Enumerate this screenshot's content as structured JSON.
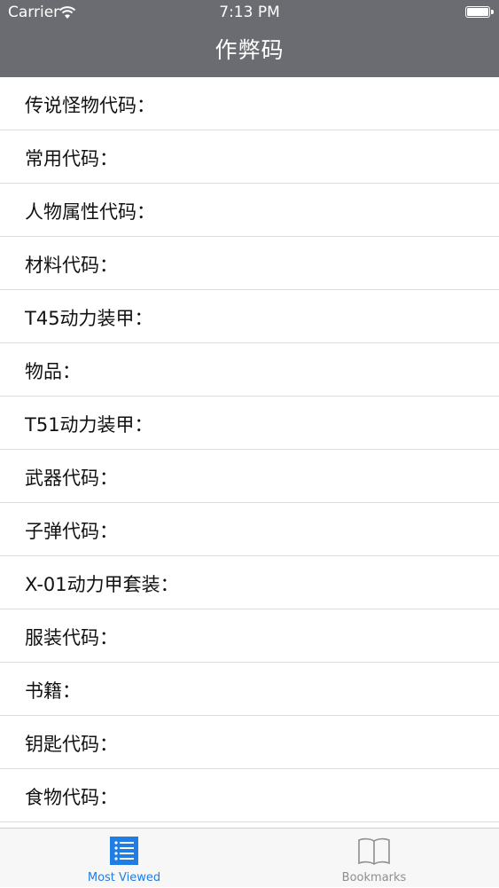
{
  "status_bar": {
    "carrier": "Carrier",
    "time": "7:13 PM"
  },
  "nav": {
    "title": "作弊码"
  },
  "list": {
    "items": [
      "传说怪物代码：",
      "常用代码：",
      "人物属性代码：",
      "材料代码：",
      "T45动力装甲：",
      "物品：",
      "T51动力装甲：",
      "武器代码：",
      "子弹代码：",
      "X-01动力甲套装：",
      "服装代码：",
      "书籍：",
      "钥匙代码：",
      "食物代码："
    ]
  },
  "tabbar": {
    "tabs": [
      {
        "label": "Most Viewed",
        "icon": "list-icon",
        "active": true
      },
      {
        "label": "Bookmarks",
        "icon": "book-icon",
        "active": false
      }
    ]
  },
  "colors": {
    "nav_bg": "#6b6c71",
    "accent": "#1f7de4",
    "inactive": "#8e8e93"
  }
}
